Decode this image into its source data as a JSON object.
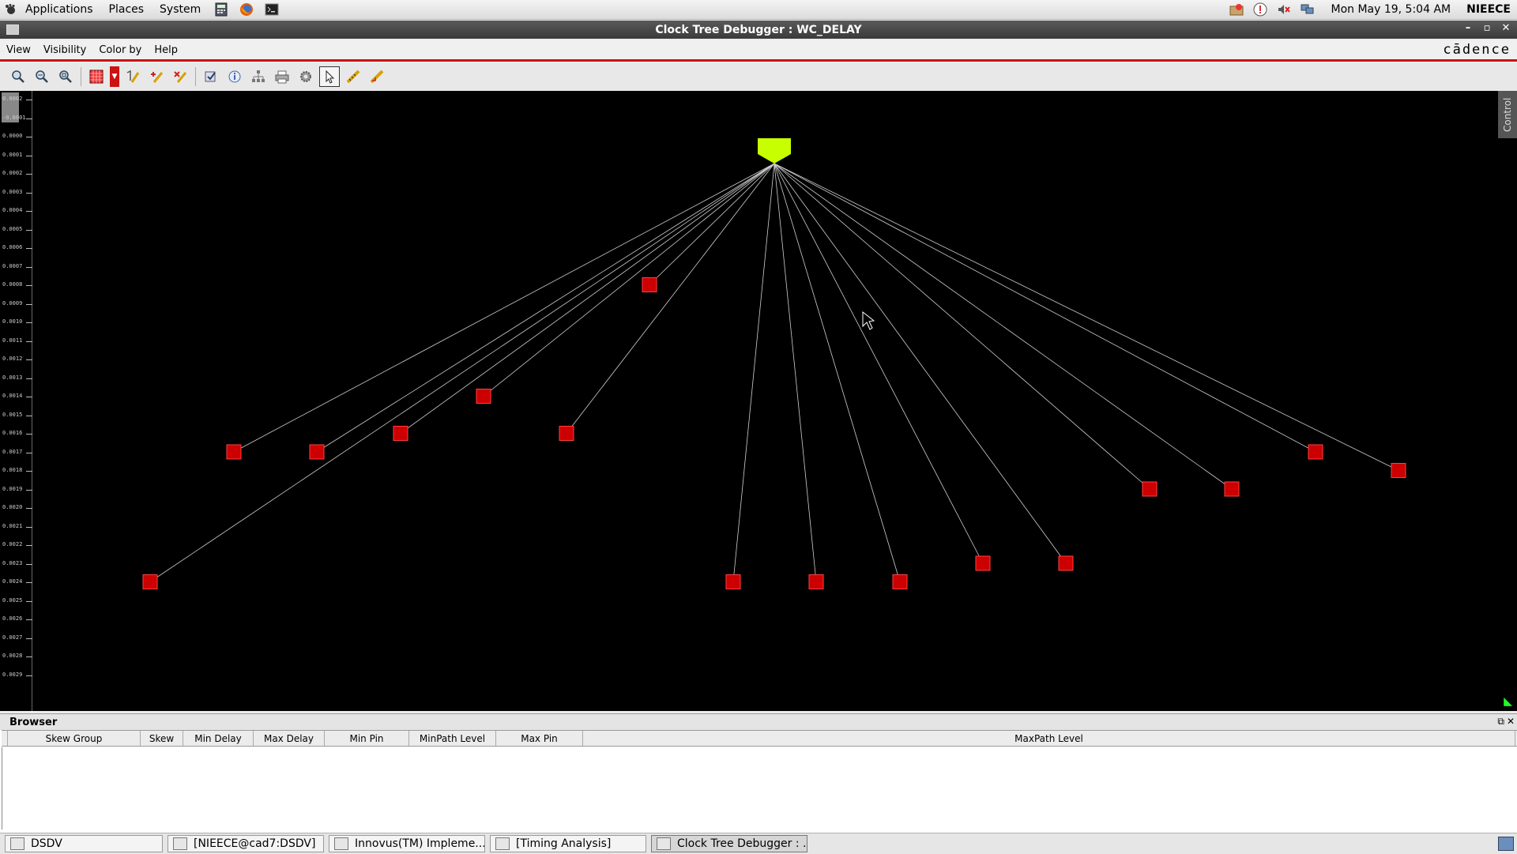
{
  "top_panel": {
    "menus": [
      "Applications",
      "Places",
      "System"
    ],
    "clock": "Mon May 19,  5:04 AM",
    "user": "NIEECE"
  },
  "window": {
    "title": "Clock Tree Debugger : WC_DELAY"
  },
  "menubar": {
    "items": [
      "View",
      "Visibility",
      "Color by",
      "Help"
    ],
    "brand": "cādence"
  },
  "toolbar": {
    "buttons": [
      "zoom-in-icon",
      "zoom-out-icon",
      "zoom-fit-icon",
      "color-pattern-icon",
      "dropdown-icon",
      "wire-tool-icon",
      "highlight-icon",
      "clear-highlight-icon",
      "select-mode-icon",
      "info-icon",
      "tree-icon",
      "print-icon",
      "settings-icon",
      "pointer-icon",
      "ruler-icon",
      "measure-icon"
    ]
  },
  "ruler": {
    "labels": [
      "0.0002",
      "-0.0001",
      "0.0000",
      "0.0001",
      "0.0002",
      "0.0003",
      "0.0004",
      "0.0005",
      "0.0006",
      "0.0007",
      "0.0008",
      "0.0009",
      "0.0010",
      "0.0011",
      "0.0012",
      "0.0013",
      "0.0014",
      "0.0015",
      "0.0016",
      "0.0017",
      "0.0018",
      "0.0019",
      "0.0020",
      "0.0021",
      "0.0022",
      "0.0023",
      "0.0024",
      "0.0025",
      "0.0026",
      "0.0027",
      "0.0028",
      "0.0029"
    ]
  },
  "canvas": {
    "control_label": "Control",
    "root_color": "#c8ff00",
    "sink_color": "#cc0000",
    "wire_color": "#d0d0d0",
    "sink_delays": [
      0.0023,
      0.0016,
      0.0016,
      0.0015,
      0.0013,
      0.0015,
      0.0007,
      0.0023,
      0.0023,
      0.0023,
      0.0022,
      0.0022,
      0.0018,
      0.0018,
      0.0016,
      0.0017
    ]
  },
  "browser": {
    "title": "Browser",
    "columns": [
      "Skew Group",
      "Skew",
      "Min Delay",
      "Max Delay",
      "Min Pin",
      "MinPath Level",
      "Max Pin",
      "MaxPath Level"
    ]
  },
  "taskbar": {
    "tasks": [
      "DSDV",
      "[NIEECE@cad7:DSDV]",
      "Innovus(TM) Impleme...",
      "[Timing Analysis]",
      "Clock Tree Debugger : ..."
    ]
  }
}
